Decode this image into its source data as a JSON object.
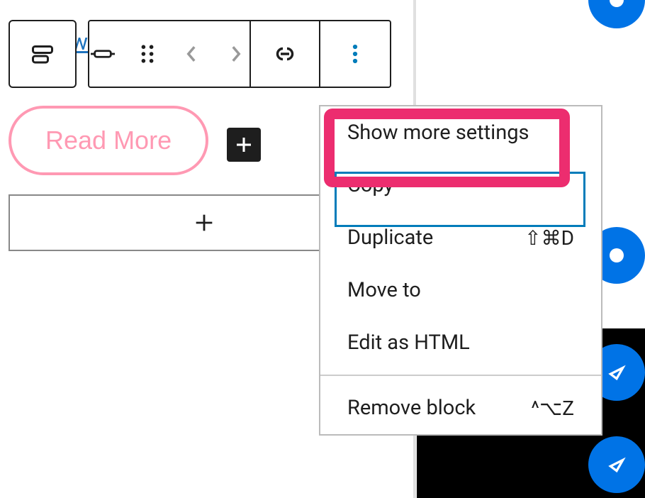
{
  "toolbar": {
    "block_type_icon": "buttons-block",
    "alignment_icon": "justify-full",
    "drag_icon": "drag-handle",
    "prev_icon": "chevron-left",
    "next_icon": "chevron-right",
    "link_icon": "link",
    "options_icon": "more-vertical"
  },
  "buttons": {
    "read_more_label": "Read More",
    "add_block_label": "+"
  },
  "partial_link_text": "wc",
  "menu": {
    "items": [
      {
        "label": "Show more settings",
        "shortcut": ""
      },
      {
        "label": "Copy",
        "shortcut": ""
      },
      {
        "label": "Duplicate",
        "shortcut": "⇧⌘D"
      },
      {
        "label": "Move to",
        "shortcut": ""
      },
      {
        "label": "Edit as HTML",
        "shortcut": ""
      },
      {
        "label": "Remove block",
        "shortcut": "^⌥Z"
      }
    ]
  },
  "colors": {
    "accent_pink": "#ff99b3",
    "highlight": "#ec2d6f",
    "wp_blue": "#007cba"
  }
}
